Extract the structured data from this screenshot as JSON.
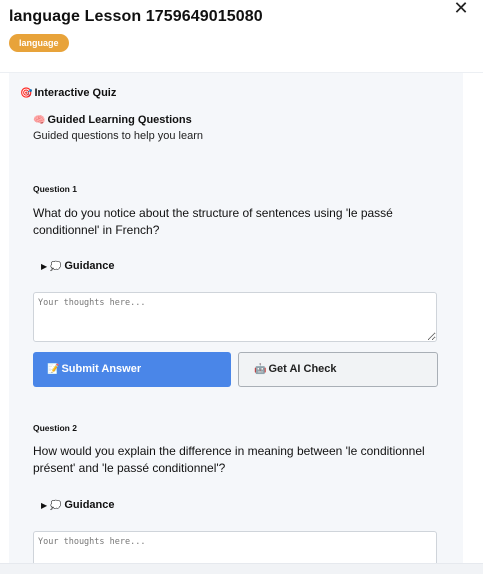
{
  "header": {
    "title": "language Lesson 1759649015080",
    "tag": "language",
    "close_icon": "close-icon",
    "close_glyph": "✕"
  },
  "quiz": {
    "section_icon": "🎯",
    "section_title": "Interactive Quiz",
    "guided_icon": "🧠",
    "guided_title": "Guided Learning Questions",
    "guided_desc": "Guided questions to help you learn"
  },
  "questions": [
    {
      "label": "Question 1",
      "text": "What do you notice about the structure of sentences using 'le passé conditionnel' in French?",
      "guidance_arrow": "▶",
      "guidance_icon": "💭",
      "guidance_label": "Guidance",
      "answer_placeholder": "Your thoughts here...",
      "submit_icon": "📝",
      "submit_label": "Submit Answer",
      "ai_icon": "🤖",
      "ai_label": "Get AI Check"
    },
    {
      "label": "Question 2",
      "text": "How would you explain the difference in meaning between 'le conditionnel présent' and 'le passé conditionnel'?",
      "guidance_arrow": "▶",
      "guidance_icon": "💭",
      "guidance_label": "Guidance",
      "answer_placeholder": "Your thoughts here..."
    }
  ]
}
